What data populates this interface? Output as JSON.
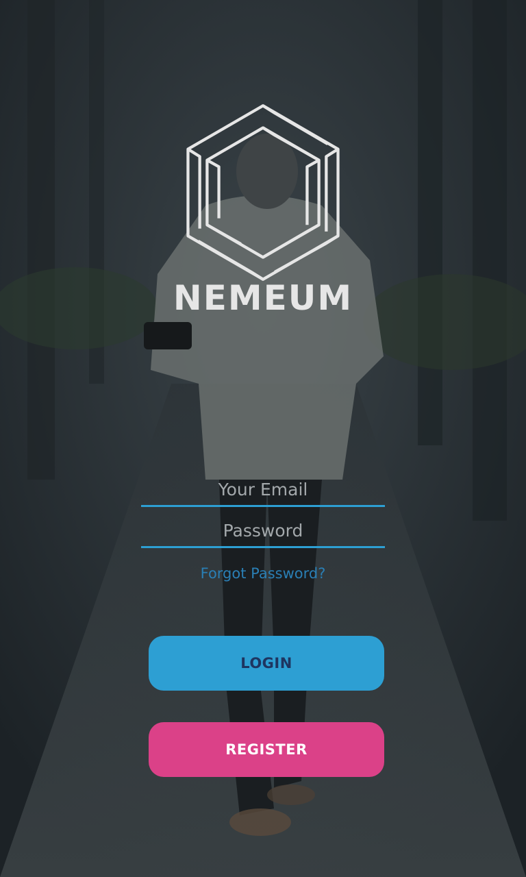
{
  "brand": {
    "name": "NEMEUM",
    "icon": "hexagon-logo-icon"
  },
  "form": {
    "email_placeholder": "Your Email",
    "password_placeholder": "Password",
    "forgot_label": "Forgot Password?"
  },
  "buttons": {
    "login_label": "LOGIN",
    "register_label": "REGISTER"
  },
  "colors": {
    "overlay": "#22282c",
    "accent_blue": "#2d9fd3",
    "forgot_link": "#2a7fb5",
    "login_bg": "#2d9fd3",
    "login_text": "#1e3560",
    "register_bg": "#db4188",
    "register_text": "#ffffff",
    "logo": "#e6e6e6"
  }
}
